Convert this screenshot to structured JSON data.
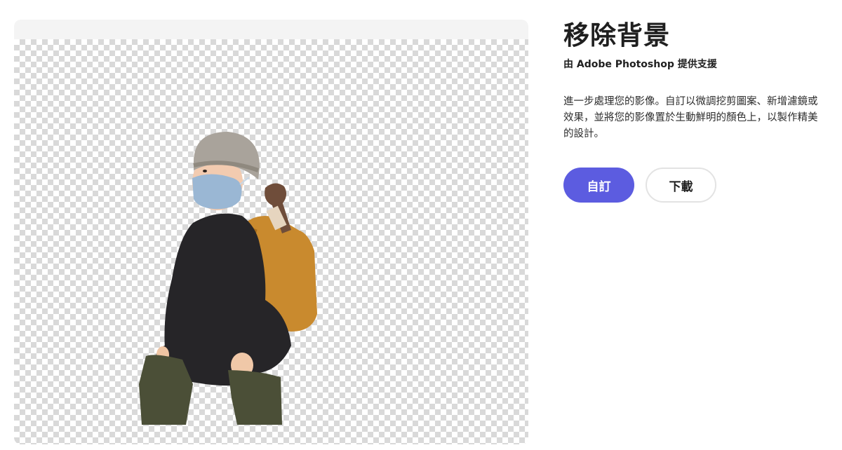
{
  "preview": {
    "subject_description": "child with knit beanie, blue face mask, black fleece jacket, olive pants and orange backpack"
  },
  "header": {
    "title": "移除背景",
    "powered_by": "由 Adobe Photoshop 提供支援"
  },
  "description": "進一步處理您的影像。自訂以微調挖剪圖案、新增濾鏡或效果，並將您的影像置於生動鮮明的顏色上，以製作精美的設計。",
  "actions": {
    "customize_label": "自訂",
    "download_label": "下載"
  },
  "colors": {
    "accent": "#5c5ce0",
    "panel_bg": "#f4f4f4"
  }
}
